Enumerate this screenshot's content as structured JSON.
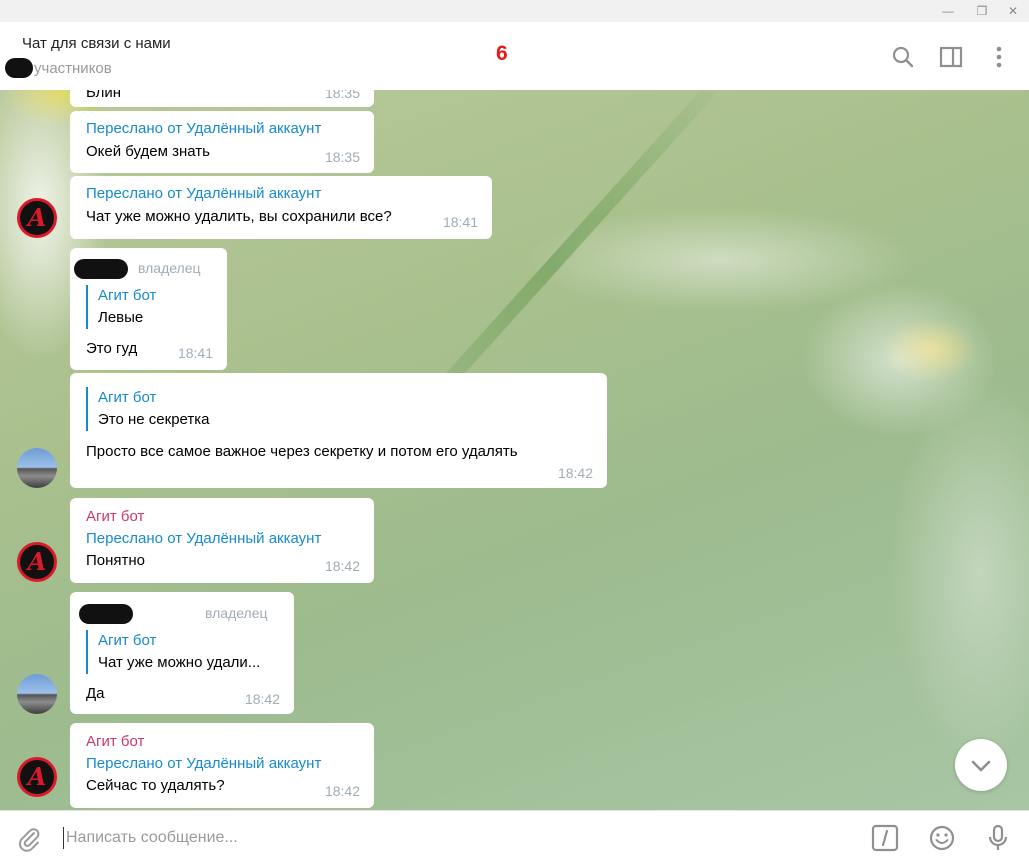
{
  "window": {
    "minimize": "—",
    "restore": "❐",
    "close": "✕"
  },
  "header": {
    "title": "Чат для связи с нами",
    "members": "участников",
    "badge": "6",
    "icons": [
      "search-icon",
      "sidebar-toggle-icon",
      "more-vert-icon"
    ]
  },
  "messages": [
    {
      "fwd": "",
      "text": "Блин",
      "time": "18:35"
    },
    {
      "fwd": "Переслано от Удалённый аккаунт",
      "text": "Окей будем знать",
      "time": "18:35"
    },
    {
      "fwd": "Переслано от Удалённый аккаунт",
      "text": "Чат уже можно удалить, вы сохранили все?",
      "time": "18:41"
    },
    {
      "role": "владелец",
      "reply_name": "Агит бот",
      "reply_text": "Левые",
      "text": "Это гуд",
      "time": "18:41"
    },
    {
      "reply_name": "Агит бот",
      "reply_text": "Это не секретка",
      "text": "Просто все самое важное через секретку и потом его удалять",
      "time": "18:42"
    },
    {
      "sender": "Агит бот",
      "fwd": "Переслано от Удалённый аккаунт",
      "text": "Понятно",
      "time": "18:42"
    },
    {
      "role": "владелец",
      "reply_name": "Агит бот",
      "reply_text": "Чат уже можно удали...",
      "text": "Да",
      "time": "18:42"
    },
    {
      "sender": "Агит бот",
      "fwd": "Переслано от Удалённый аккаунт",
      "text": "Сейчас то удалять?",
      "time": "18:42"
    }
  ],
  "avatars": {
    "bot_letter": "A"
  },
  "composer": {
    "placeholder": "Написать сообщение..."
  },
  "colors": {
    "accent": "#168acd",
    "sender": "#c83b6a",
    "badge": "#e21b1b"
  }
}
